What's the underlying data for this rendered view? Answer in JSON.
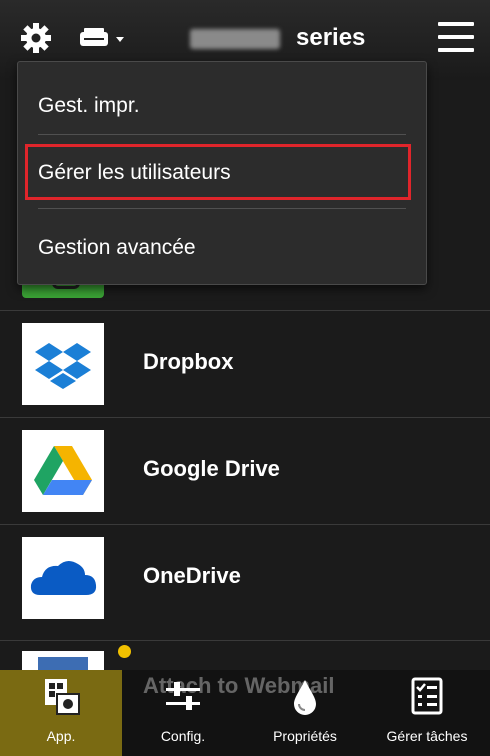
{
  "header": {
    "printer_series": "series",
    "icons": [
      "gear-icon",
      "printer-select-icon",
      "menu-icon"
    ]
  },
  "menu": {
    "items": [
      {
        "label": "Gest. impr."
      },
      {
        "label": "Gérer les utilisateurs",
        "selected": true
      },
      {
        "label": "Gestion avancée"
      }
    ],
    "highlight_color": "#e0252b"
  },
  "apps": [
    {
      "name": "Dropbox",
      "icon": "dropbox-icon"
    },
    {
      "name": "Google Drive",
      "icon": "google-drive-icon"
    },
    {
      "name": "OneDrive",
      "icon": "onedrive-icon"
    },
    {
      "name": "Attach to Webmail",
      "icon": "webmail-icon"
    }
  ],
  "tabs": [
    {
      "label": "App.",
      "icon": "apps-icon",
      "active": true
    },
    {
      "label": "Config.",
      "icon": "sliders-icon"
    },
    {
      "label": "Propriétés",
      "icon": "ink-drop-icon"
    },
    {
      "label": "Gérer tâches",
      "icon": "task-list-icon"
    }
  ],
  "colors": {
    "active_tab": "#7a6a12",
    "background": "#1b1b1b"
  }
}
